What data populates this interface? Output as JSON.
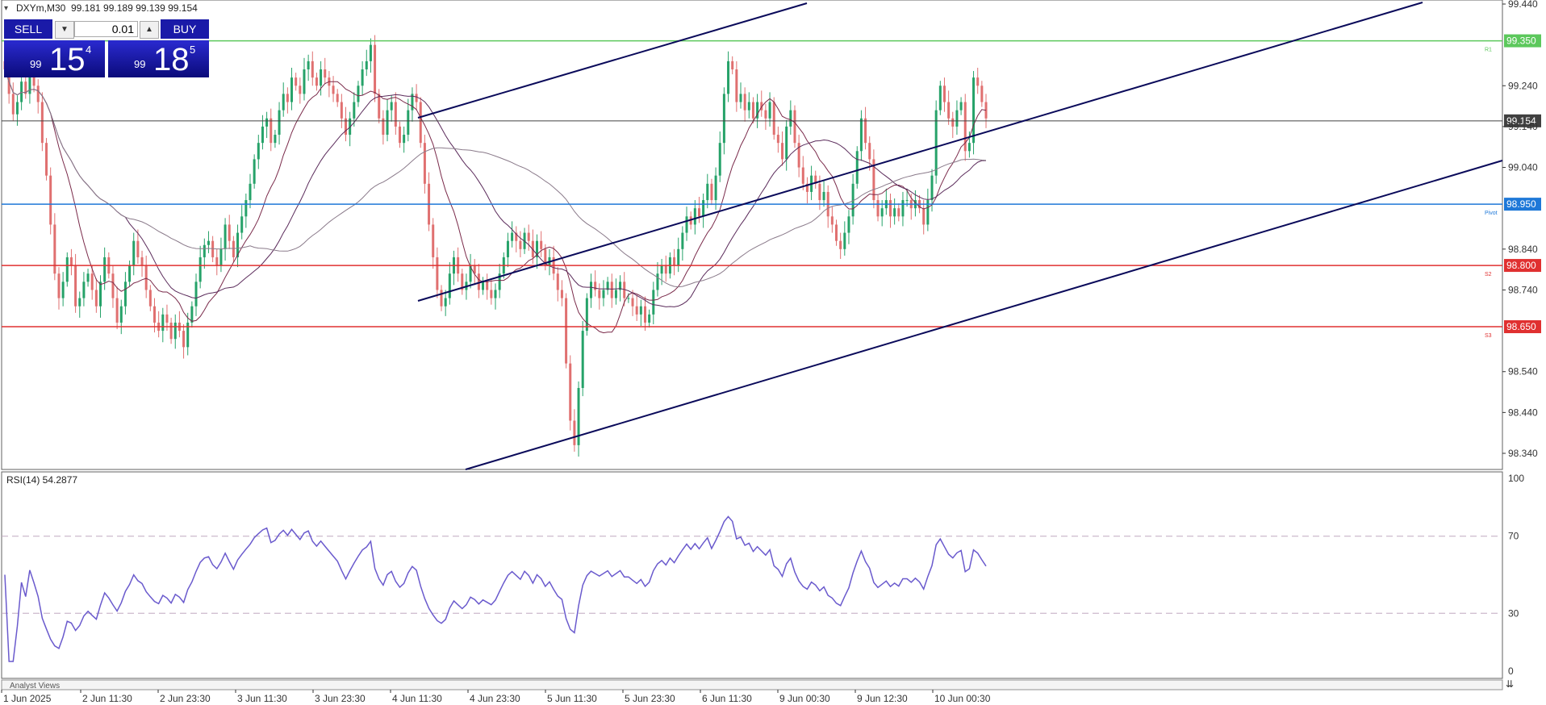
{
  "header": {
    "symbol": "DXYm,M30",
    "ohlc": "99.181 99.189 99.139 99.154"
  },
  "trade_panel": {
    "sell_label": "SELL",
    "buy_label": "BUY",
    "lot": "0.01",
    "sell_price_small": "99",
    "sell_price_big": "15",
    "sell_price_sup": "4",
    "buy_price_small": "99",
    "buy_price_big": "18",
    "buy_price_sup": "5"
  },
  "price_axis": {
    "labels": [
      "99.440",
      "99.240",
      "99.140",
      "99.040",
      "98.840",
      "98.740",
      "98.540",
      "98.440",
      "98.340"
    ]
  },
  "levels": [
    {
      "name": "R1",
      "price": "99.350",
      "color": "#5cc85c",
      "tag": "R1"
    },
    {
      "name": "current",
      "price": "99.154",
      "color": "#404040",
      "tag": ""
    },
    {
      "name": "Pivot",
      "price": "98.950",
      "color": "#1e78d8",
      "tag": "Pivot"
    },
    {
      "name": "S2",
      "price": "98.800",
      "color": "#e03030",
      "tag": "S2"
    },
    {
      "name": "S3",
      "price": "98.650",
      "color": "#e03030",
      "tag": "S3"
    }
  ],
  "rsi": {
    "label": "RSI(14) 54.2877",
    "levels": [
      "100",
      "70",
      "30",
      "0"
    ]
  },
  "time_axis": {
    "labels": [
      "1 Jun 2025",
      "2 Jun 11:30",
      "2 Jun 23:30",
      "3 Jun 11:30",
      "3 Jun 23:30",
      "4 Jun 11:30",
      "4 Jun 23:30",
      "5 Jun 11:30",
      "5 Jun 23:30",
      "6 Jun 11:30",
      "9 Jun 00:30",
      "9 Jun 12:30",
      "10 Jun 00:30"
    ]
  },
  "footer": {
    "analyst_views": "Analyst Views"
  },
  "colors": {
    "bull": "#26a269",
    "bear": "#e07070",
    "rsi_line": "#6a5acd",
    "channel": "#0a0a5a"
  },
  "chart_data": {
    "type": "candlestick",
    "ylim": [
      98.3,
      99.45
    ],
    "closes": [
      99.28,
      99.22,
      99.17,
      99.2,
      99.25,
      99.22,
      99.27,
      99.24,
      99.2,
      99.1,
      99.02,
      98.9,
      98.78,
      98.72,
      98.76,
      98.82,
      98.8,
      98.7,
      98.72,
      98.76,
      98.78,
      98.74,
      98.7,
      98.76,
      98.82,
      98.78,
      98.72,
      98.66,
      98.7,
      98.76,
      98.8,
      98.86,
      98.82,
      98.8,
      98.74,
      98.7,
      98.66,
      98.64,
      98.68,
      98.66,
      98.62,
      98.66,
      98.64,
      98.6,
      98.66,
      98.7,
      98.76,
      98.82,
      98.85,
      98.86,
      98.82,
      98.8,
      98.84,
      98.9,
      98.86,
      98.82,
      98.88,
      98.92,
      98.96,
      99.0,
      99.06,
      99.1,
      99.14,
      99.16,
      99.1,
      99.12,
      99.18,
      99.22,
      99.2,
      99.26,
      99.24,
      99.22,
      99.28,
      99.3,
      99.26,
      99.24,
      99.28,
      99.26,
      99.24,
      99.22,
      99.2,
      99.16,
      99.12,
      99.16,
      99.2,
      99.24,
      99.28,
      99.3,
      99.34,
      99.22,
      99.16,
      99.12,
      99.18,
      99.2,
      99.14,
      99.1,
      99.12,
      99.18,
      99.22,
      99.2,
      99.1,
      99.0,
      98.9,
      98.82,
      98.74,
      98.7,
      98.72,
      98.78,
      98.82,
      98.78,
      98.74,
      98.76,
      98.8,
      98.78,
      98.74,
      98.76,
      98.74,
      98.72,
      98.74,
      98.78,
      98.82,
      98.86,
      98.88,
      98.86,
      98.84,
      98.88,
      98.86,
      98.82,
      98.86,
      98.84,
      98.8,
      98.82,
      98.78,
      98.74,
      98.72,
      98.56,
      98.42,
      98.36,
      98.5,
      98.64,
      98.72,
      98.76,
      98.74,
      98.72,
      98.74,
      98.76,
      98.72,
      98.74,
      98.76,
      98.72,
      98.72,
      98.7,
      98.68,
      98.7,
      98.66,
      98.68,
      98.74,
      98.78,
      98.8,
      98.78,
      98.82,
      98.8,
      98.84,
      98.88,
      98.92,
      98.9,
      98.94,
      98.92,
      98.96,
      99.0,
      98.96,
      99.02,
      99.1,
      99.22,
      99.3,
      99.28,
      99.2,
      99.22,
      99.18,
      99.2,
      99.16,
      99.2,
      99.18,
      99.16,
      99.2,
      99.12,
      99.1,
      99.06,
      99.14,
      99.18,
      99.1,
      99.04,
      99.0,
      98.98,
      99.02,
      99.0,
      98.96,
      98.98,
      98.92,
      98.9,
      98.86,
      98.84,
      98.88,
      98.92,
      99.0,
      99.08,
      99.16,
      99.1,
      99.06,
      98.96,
      98.92,
      98.94,
      98.96,
      98.92,
      98.94,
      98.92,
      98.96,
      98.96,
      98.94,
      98.96,
      98.94,
      98.9,
      98.96,
      99.02,
      99.18,
      99.24,
      99.2,
      99.16,
      99.14,
      99.18,
      99.2,
      99.08,
      99.1,
      99.26,
      99.24,
      99.2,
      99.16
    ]
  }
}
